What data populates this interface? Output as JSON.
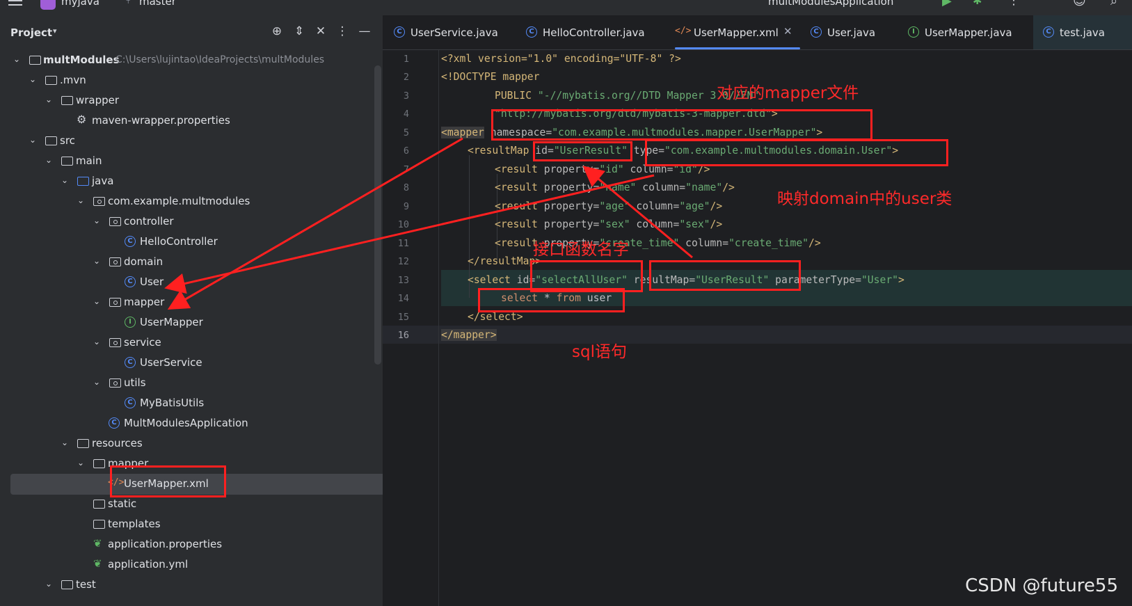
{
  "topbar": {
    "project_name": "myjava",
    "branch": "master",
    "run_config": "multModulesApplication"
  },
  "panel": {
    "title": "Project"
  },
  "tree": [
    {
      "label": "multModules",
      "path": "C:\\Users\\lujintao\\IdeaProjects\\multModules"
    },
    {
      "label": ".mvn"
    },
    {
      "label": "wrapper"
    },
    {
      "label": "maven-wrapper.properties"
    },
    {
      "label": "src"
    },
    {
      "label": "main"
    },
    {
      "label": "java"
    },
    {
      "label": "com.example.multmodules"
    },
    {
      "label": "controller"
    },
    {
      "label": "HelloController"
    },
    {
      "label": "domain"
    },
    {
      "label": "User"
    },
    {
      "label": "mapper"
    },
    {
      "label": "UserMapper"
    },
    {
      "label": "service"
    },
    {
      "label": "UserService"
    },
    {
      "label": "utils"
    },
    {
      "label": "MyBatisUtils"
    },
    {
      "label": "MultModulesApplication"
    },
    {
      "label": "resources"
    },
    {
      "label": "mapper"
    },
    {
      "label": "UserMapper.xml"
    },
    {
      "label": "static"
    },
    {
      "label": "templates"
    },
    {
      "label": "application.properties"
    },
    {
      "label": "application.yml"
    },
    {
      "label": "test"
    }
  ],
  "tabs": [
    {
      "label": "UserService.java"
    },
    {
      "label": "HelloController.java"
    },
    {
      "label": "UserMapper.xml"
    },
    {
      "label": "User.java"
    },
    {
      "label": "UserMapper.java"
    },
    {
      "label": "test.java"
    }
  ],
  "line_numbers": [
    "1",
    "2",
    "3",
    "4",
    "5",
    "6",
    "7",
    "8",
    "9",
    "10",
    "11",
    "12",
    "13",
    "14",
    "15",
    "16"
  ],
  "code": {
    "l1_decl": "<?xml version=\"1.0\" encoding=\"UTF-8\" ?>",
    "l2_doctype": "<!DOCTYPE mapper",
    "l3_public": "PUBLIC ",
    "l3_id": "\"-//mybatis.org//DTD Mapper 3.0//EN\"",
    "l4_dtd": "\"http://mybatis.org/dtd/mybatis-3-mapper.dtd\"",
    "l4_end": ">",
    "l5_tag": "<mapper",
    "l5_attr": " namespace=",
    "l5_val": "\"com.example.multmodules.mapper.UserMapper\"",
    "l5_end": ">",
    "l6_tag": "<resultMap",
    "l6_attr1": " id=",
    "l6_val1": "\"UserResult\"",
    "l6_attr2": " type=",
    "l6_val2": "\"com.example.multmodules.domain.User\"",
    "l6_end": ">",
    "results": [
      {
        "prop": "\"id\"",
        "col": "\"id\""
      },
      {
        "prop": "\"name\"",
        "col": "\"name\""
      },
      {
        "prop": "\"age\"",
        "col": "\"age\""
      },
      {
        "prop": "\"sex\"",
        "col": "\"sex\""
      },
      {
        "prop": "\"create_time\"",
        "col": "\"create_time\""
      }
    ],
    "result_tag": "<result",
    "result_prop_attr": " property=",
    "result_col_attr": " column=",
    "result_end": "/>",
    "l12": "</resultMap>",
    "l13_tag": "<select",
    "l13_attr1": " id=",
    "l13_val1": "\"selectAllUser\"",
    "l13_attr2": " resultMap=",
    "l13_val2": "\"UserResult\"",
    "l13_attr3": " parameterType=",
    "l13_val3": "\"User\"",
    "l13_end": ">",
    "l14_select": "select",
    "l14_star": " * ",
    "l14_from": "from",
    "l14_table": " user",
    "l15": "</select>",
    "l16": "</mapper>"
  },
  "annotations": {
    "mapper_file": "对应的mapper文件",
    "domain_user": "映射domain中的user类",
    "interface_method": "接口函数名字",
    "sql": "sql语句"
  },
  "watermark": "CSDN @future55",
  "colors": {
    "annotation": "#ff2020",
    "accent": "#548af7",
    "xml_tag": "#d5b778",
    "xml_value": "#6aab73"
  }
}
